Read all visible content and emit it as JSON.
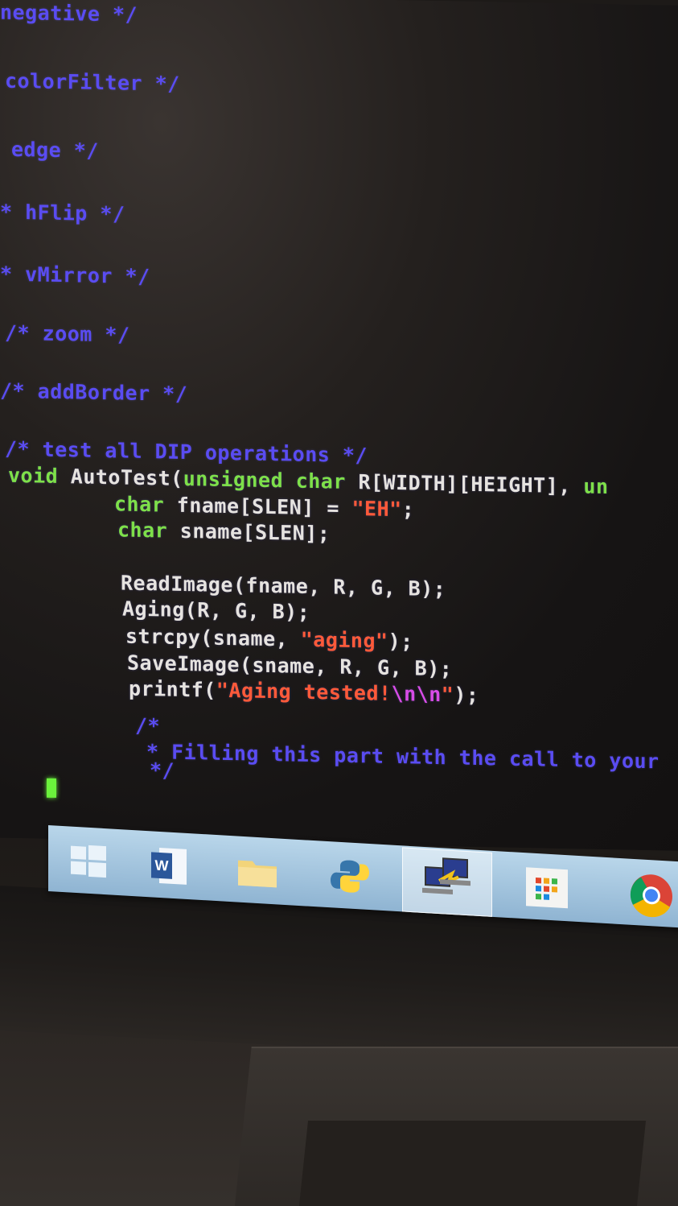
{
  "code_lines": [
    {
      "id": "l1",
      "parts": [
        {
          "t": "negative */",
          "c": "cmt"
        }
      ]
    },
    {
      "id": "l2",
      "parts": [
        {
          "t": "colorFilter */",
          "c": "cmt"
        }
      ]
    },
    {
      "id": "l3",
      "parts": [
        {
          "t": "edge */",
          "c": "cmt"
        }
      ]
    },
    {
      "id": "l4",
      "parts": [
        {
          "t": "* hFlip */",
          "c": "cmt"
        }
      ]
    },
    {
      "id": "l5",
      "parts": [
        {
          "t": "* vMirror */",
          "c": "cmt"
        }
      ]
    },
    {
      "id": "l6",
      "parts": [
        {
          "t": "/* zoom */",
          "c": "cmt"
        }
      ]
    },
    {
      "id": "l7",
      "parts": [
        {
          "t": "/* addBorder */",
          "c": "cmt"
        }
      ]
    },
    {
      "id": "l8",
      "parts": [
        {
          "t": "/* test all DIP operations */",
          "c": "cmt"
        }
      ]
    },
    {
      "id": "l9",
      "parts": [
        {
          "t": "void ",
          "c": "kw"
        },
        {
          "t": "AutoTest(",
          "c": "txt"
        },
        {
          "t": "unsigned char",
          "c": "kw"
        },
        {
          "t": " R[WIDTH][HEIGHT], ",
          "c": "txt"
        },
        {
          "t": "un",
          "c": "kw"
        }
      ]
    },
    {
      "id": "l10",
      "parts": [
        {
          "t": "char",
          "c": "kw"
        },
        {
          "t": " fname[SLEN] = ",
          "c": "txt"
        },
        {
          "t": "\"EH\"",
          "c": "str"
        },
        {
          "t": ";",
          "c": "txt"
        }
      ]
    },
    {
      "id": "l11",
      "parts": [
        {
          "t": "char",
          "c": "kw"
        },
        {
          "t": " sname[SLEN];",
          "c": "txt"
        }
      ]
    },
    {
      "id": "l12",
      "parts": [
        {
          "t": "ReadImage(fname, R, G, B);",
          "c": "txt"
        }
      ]
    },
    {
      "id": "l13",
      "parts": [
        {
          "t": "Aging(R, G, B);",
          "c": "txt"
        }
      ]
    },
    {
      "id": "l14",
      "parts": [
        {
          "t": "strcpy(sname, ",
          "c": "txt"
        },
        {
          "t": "\"aging\"",
          "c": "str"
        },
        {
          "t": ");",
          "c": "txt"
        }
      ]
    },
    {
      "id": "l15",
      "parts": [
        {
          "t": "SaveImage(sname, R, G, B);",
          "c": "txt"
        }
      ]
    },
    {
      "id": "l16",
      "parts": [
        {
          "t": "printf(",
          "c": "txt"
        },
        {
          "t": "\"Aging tested!",
          "c": "str"
        },
        {
          "t": "\\n\\n",
          "c": "esc"
        },
        {
          "t": "\"",
          "c": "str"
        },
        {
          "t": ");",
          "c": "txt"
        }
      ]
    },
    {
      "id": "l17",
      "parts": [
        {
          "t": "/*",
          "c": "cmt"
        }
      ]
    },
    {
      "id": "l18",
      "parts": [
        {
          "t": "* Filling this part with the call to your",
          "c": "cmt"
        }
      ]
    },
    {
      "id": "l19",
      "parts": [
        {
          "t": "*/",
          "c": "cmt"
        }
      ]
    }
  ],
  "taskbar": {
    "icons": [
      {
        "name": "windows-start-icon",
        "active": false
      },
      {
        "name": "word-icon",
        "active": false
      },
      {
        "name": "file-explorer-icon",
        "active": false
      },
      {
        "name": "python-icon",
        "active": false
      },
      {
        "name": "remote-terminal-icon",
        "active": true
      },
      {
        "name": "apps-grid-icon",
        "active": false
      },
      {
        "name": "chrome-icon",
        "active": false
      }
    ]
  },
  "colors": {
    "comment": "#5a4cf2",
    "keyword": "#7ee04a",
    "text": "#e6e3e0",
    "string": "#ff5a3a",
    "escape": "#d84ce6",
    "cursor": "#6bf23c"
  }
}
